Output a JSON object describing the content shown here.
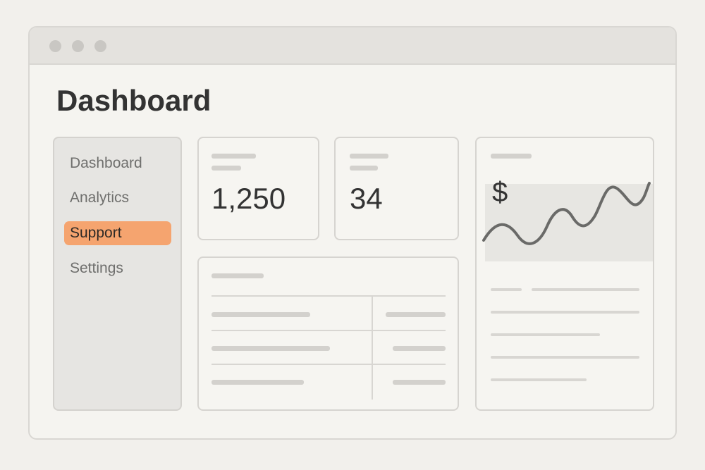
{
  "header": {
    "title": "Dashboard"
  },
  "sidebar": {
    "items": [
      {
        "label": "Dashboard",
        "active": false
      },
      {
        "label": "Analytics",
        "active": false
      },
      {
        "label": "Support",
        "active": true
      },
      {
        "label": "Settings",
        "active": false
      }
    ]
  },
  "stats": [
    {
      "value": "1,250"
    },
    {
      "value": "34"
    }
  ],
  "revenue_card": {
    "symbol": "$"
  },
  "colors": {
    "accent": "#f5a46f",
    "background": "#f2f0ec",
    "text": "#333333"
  }
}
